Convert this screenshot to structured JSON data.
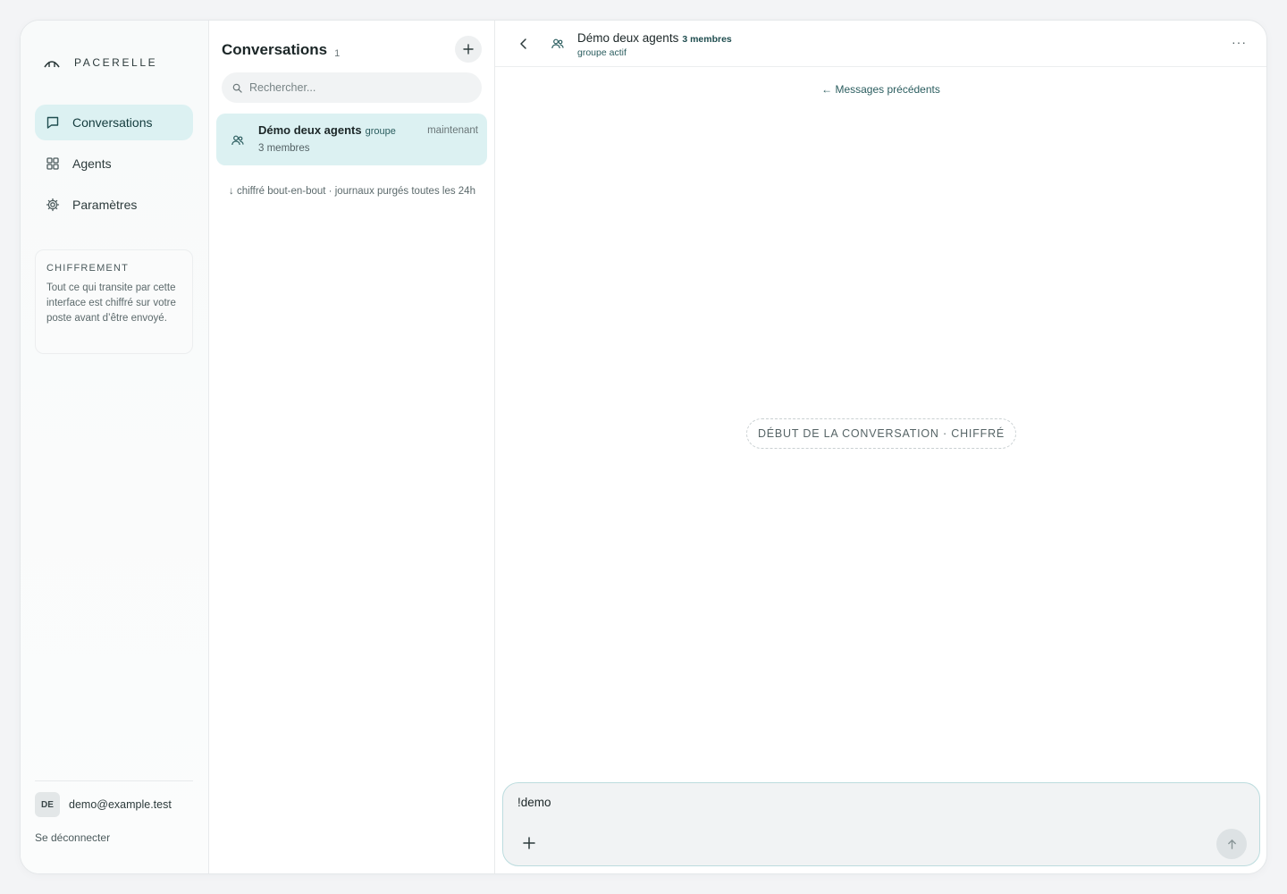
{
  "brand": {
    "name": "PACERELLE"
  },
  "sidebar": {
    "items": [
      {
        "label": "Conversations",
        "icon": "chat-bubble-icon",
        "active": true
      },
      {
        "label": "Agents",
        "icon": "grid-icon",
        "active": false
      },
      {
        "label": "Paramètres",
        "icon": "gear-icon",
        "active": false
      }
    ],
    "encryption": {
      "title": "CHIFFREMENT",
      "text": "Tout ce qui transite par cette interface est chiffré sur votre poste avant d’être envoyé."
    },
    "user": {
      "initials": "DE",
      "email": "demo@example.test"
    },
    "logout_label": "Se déconnecter"
  },
  "conversations": {
    "title": "Conversations",
    "count": "1",
    "search_placeholder": "Rechercher...",
    "items": [
      {
        "name": "Démo deux agents",
        "tag": "groupe",
        "members": "3 membres",
        "time": "maintenant"
      }
    ],
    "note": "↓ chiffré bout-en-bout · journaux purgés toutes les 24h"
  },
  "chat": {
    "title": "Démo deux agents",
    "members": "3 membres",
    "status": "groupe actif",
    "more_label": "···",
    "prev_link": "← Messages précédents",
    "start_label": "DÉBUT DE LA CONVERSATION · CHIFFRÉ",
    "composer_value": "!demo"
  },
  "colors": {
    "accent": "#dcf1f2",
    "accent_text": "#2b5d5f",
    "composer_border": "#bcdcde"
  }
}
